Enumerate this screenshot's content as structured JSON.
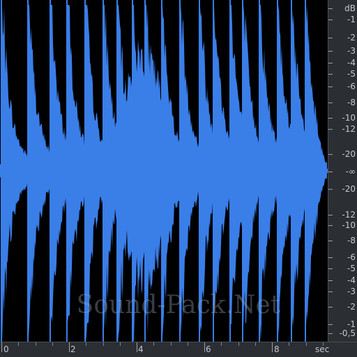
{
  "watermark": "Sound-Pack.Net",
  "colors": {
    "waveform": "#3a7ee8",
    "background": "#000000",
    "ruler": "#2b2f34",
    "ruler_text": "#c4c9ce"
  },
  "db_ruler": {
    "unit": "dB",
    "labels": [
      "-1",
      "-2",
      "-3",
      "-4",
      "-5",
      "-6",
      "-8",
      "-10",
      "-12",
      "-20",
      "-∞",
      "-20",
      "-12",
      "-10",
      "-8",
      "-6",
      "-5",
      "-4",
      "-3",
      "-2",
      "-1",
      "-0,5"
    ]
  },
  "time_ruler": {
    "unit": "sec",
    "labels": [
      "0",
      "2",
      "4",
      "6",
      "8"
    ]
  }
}
